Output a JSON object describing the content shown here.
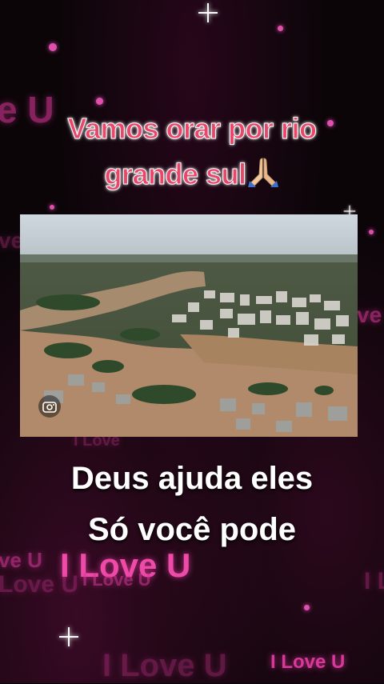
{
  "headline": {
    "line1": "Vamos orar por rio",
    "line2": "grande sul"
  },
  "emoji": "praying-hands-emoji",
  "photo": {
    "icon": "camera-lens-icon"
  },
  "caption": {
    "line1": "Deus ajuda eles",
    "line2": "Só você pode"
  },
  "background_texts": {
    "t1": "e U",
    "t2": "ve",
    "t3": "ve",
    "t4": "I Love",
    "t5": "ve U",
    "t6": "I Love U",
    "t7": "Love U",
    "t8": "I Love U",
    "t9": "I Love U",
    "t10": "I Love U",
    "t11": "I Love U"
  },
  "colors": {
    "accent": "#e8476a",
    "glow": "#d8389a",
    "background": "#0b0508"
  }
}
